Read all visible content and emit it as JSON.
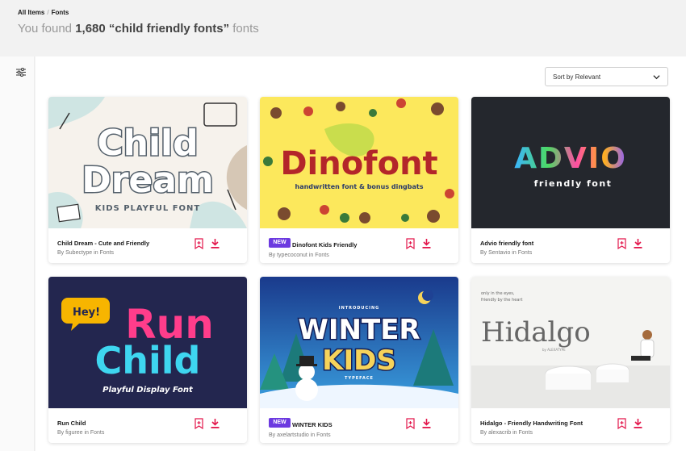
{
  "breadcrumb": {
    "root": "All Items",
    "separator": "/",
    "current": "Fonts"
  },
  "results": {
    "prefix": "You found",
    "count_query": "1,680 “child friendly fonts”",
    "suffix": "fonts"
  },
  "sidebar": {
    "filter_icon": "sliders-icon"
  },
  "sort": {
    "label": "Sort by Relevant",
    "icon": "chevron-down-icon"
  },
  "colors": {
    "accent": "#e3164b",
    "new_badge": "#6c3ae0"
  },
  "items": [
    {
      "title": "Child Dream - Cute and Friendly",
      "author": "By Subectype in Fonts",
      "is_new": false,
      "preview": {
        "line1": "Child",
        "line2": "Dream",
        "tagline": "KIDS PLAYFUL FONT"
      }
    },
    {
      "title": "Dinofont Kids Friendly",
      "author": "By typecoconut in Fonts",
      "is_new": true,
      "badge": "NEW",
      "preview": {
        "line1": "Dinofont",
        "tagline": "handwritten font & bonus dingbats"
      }
    },
    {
      "title": "Advio friendly font",
      "author": "By Sentavio in Fonts",
      "is_new": false,
      "preview": {
        "line1": "ADVIO",
        "tagline": "friendly font"
      }
    },
    {
      "title": "Run Child",
      "author": "By figuree in Fonts",
      "is_new": false,
      "preview": {
        "bubble": "Hey!",
        "line1": "Run",
        "line2": "Child",
        "tagline": "Playful Display Font"
      }
    },
    {
      "title": "WINTER KIDS",
      "author": "By axelartstudio in Fonts",
      "is_new": true,
      "badge": "NEW",
      "preview": {
        "intro": "INTRODUCING",
        "line1": "WINTER",
        "line2": "KIDS",
        "tagline": "TYPEFACE"
      }
    },
    {
      "title": "Hidalgo - Friendly Handwriting Font",
      "author": "By alexacrib in Fonts",
      "is_new": false,
      "preview": {
        "small1": "only in the eyes,",
        "small2": "friendly by the heart",
        "line1": "Hidalgo",
        "byline": "by ALEXATYPE"
      }
    }
  ]
}
